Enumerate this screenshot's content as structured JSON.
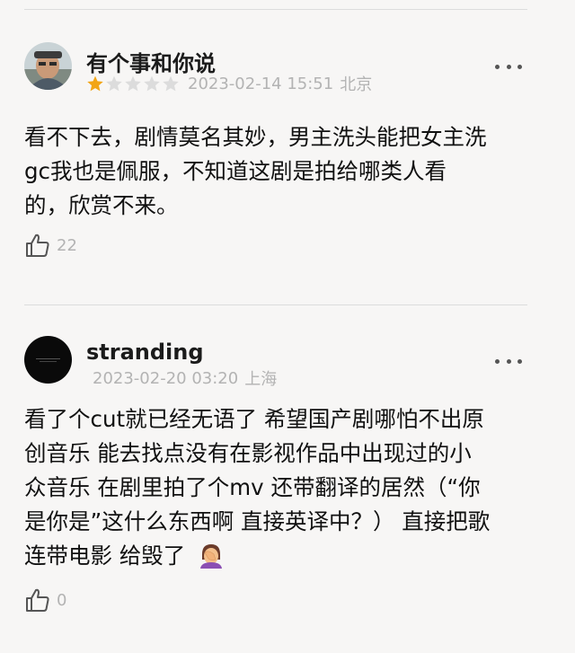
{
  "reviews": [
    {
      "username": "有个事和你说",
      "rating": 1,
      "rating_max": 5,
      "date": "2023-02-14 15:51",
      "location": "北京",
      "body_lines": [
        "看不下去，剧情莫名其妙，男主洗头能把女主洗",
        "gc我也是佩服，不知道这剧是拍给哪类人看",
        "的，欣赏不来。"
      ],
      "likes": "22"
    },
    {
      "username": "stranding",
      "date": "2023-02-20 03:20",
      "location": "上海",
      "body_lines": [
        "看了个cut就已经无语了 希望国产剧哪怕不出原",
        "创音乐 能去找点没有在影视作品中出现过的小",
        "众音乐  在剧里拍了个mv 还带翻译的居然（“你",
        "是你是”这什么东西啊 直接英译中？）  直接把歌",
        "连带电影 给毁了"
      ],
      "emoji": "facepalm",
      "likes": "0"
    }
  ],
  "colors": {
    "background": "#f7f6f5",
    "star_filled": "#f2a516",
    "star_empty": "#dcdcdc",
    "meta_text": "#b3b3b3"
  },
  "icons": [
    "more-options-icon",
    "thumbs-up-icon",
    "star-icon",
    "facepalm-emoji"
  ]
}
